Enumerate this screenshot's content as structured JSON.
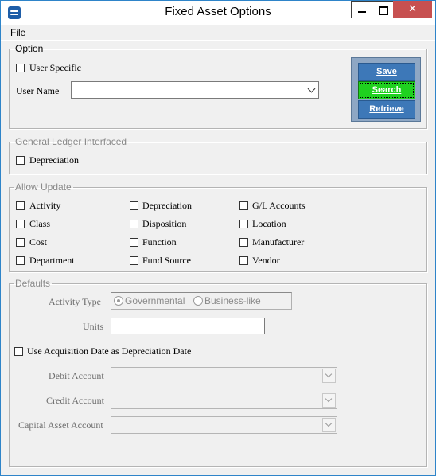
{
  "window": {
    "title": "Fixed Asset Options"
  },
  "menu": {
    "file": "File"
  },
  "option_group": {
    "legend": "Option",
    "user_specific": "User Specific",
    "user_name_label": "User Name",
    "user_name_value": ""
  },
  "actions": {
    "save": "Save",
    "search": "Search",
    "retrieve": "Retrieve"
  },
  "gl_group": {
    "legend": "General Ledger Interfaced",
    "depreciation": "Depreciation"
  },
  "allow_update": {
    "legend": "Allow Update",
    "col1": [
      "Activity",
      "Class",
      "Cost",
      "Department"
    ],
    "col2": [
      "Depreciation",
      "Disposition",
      "Function",
      "Fund Source"
    ],
    "col3": [
      "G/L Accounts",
      "Location",
      "Manufacturer",
      "Vendor"
    ]
  },
  "defaults": {
    "legend": "Defaults",
    "activity_type_label": "Activity Type",
    "radio_governmental": "Governmental",
    "radio_business": "Business-like",
    "units_label": "Units",
    "units_value": "",
    "use_acq_date": "Use Acquisition Date as Depreciation Date",
    "debit_account_label": "Debit Account",
    "credit_account_label": "Credit Account",
    "capital_asset_label": "Capital Asset Account"
  }
}
